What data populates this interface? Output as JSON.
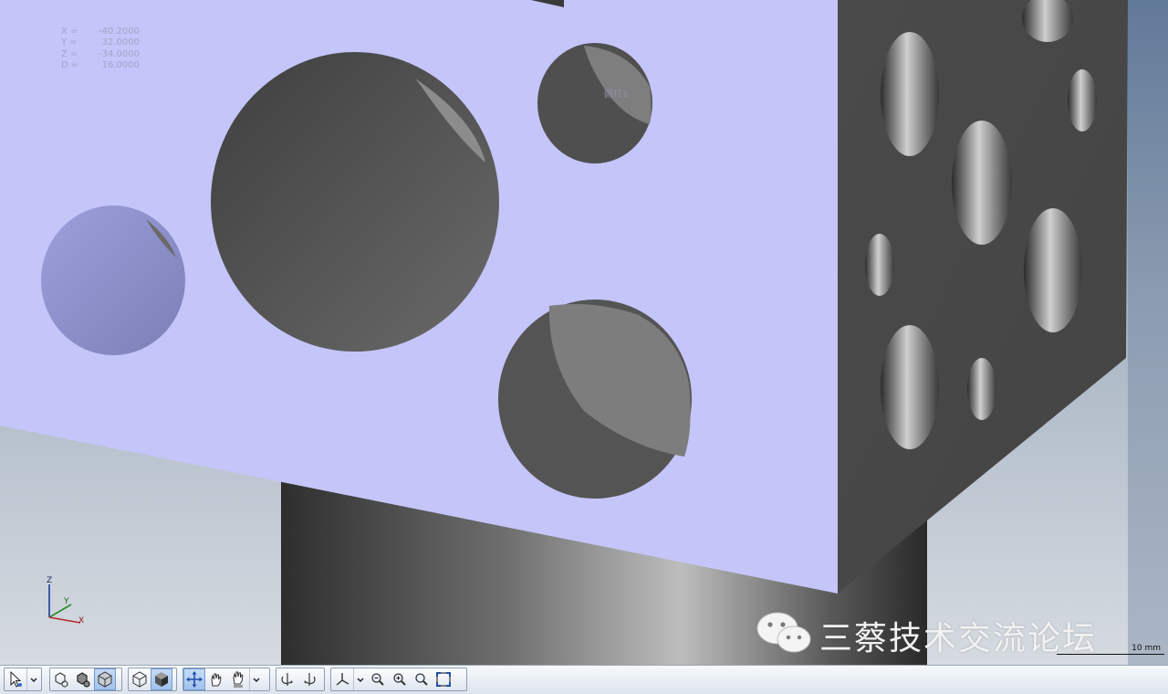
{
  "viewport": {
    "coordinates": [
      {
        "axis": "X =",
        "value": "-40.2000"
      },
      {
        "axis": "Y =",
        "value": "32.0000"
      },
      {
        "axis": "Z =",
        "value": "-34.0000"
      },
      {
        "axis": "D =",
        "value": "16.0000"
      }
    ],
    "feature_label": "圆柱1",
    "triad": {
      "x": "X",
      "y": "Y",
      "z": "Z"
    },
    "scale_bar": "10 mm",
    "watermark_text": "三蔡技术交流论坛",
    "colors": {
      "top_face": "#c4c6f9",
      "side_face": "#4b4b4b",
      "background_top": "#5e7796",
      "background_bottom": "#d4d9df",
      "toolbar_active": "#a8c8f0"
    }
  },
  "toolbar": {
    "buttons": [
      {
        "name": "select-mode-icon",
        "active": false,
        "dropdown": true
      },
      {
        "name": "shaded-edges-icon",
        "active": false
      },
      {
        "name": "shaded-outline-icon",
        "active": false
      },
      {
        "name": "solid-view-icon",
        "active": true
      },
      {
        "name": "wireframe-box-icon",
        "active": false
      },
      {
        "name": "solid-box-icon",
        "active": true
      },
      {
        "name": "pan-move-icon",
        "active": true
      },
      {
        "name": "hand-icon",
        "active": false
      },
      {
        "name": "hand-xyz-icon",
        "active": false,
        "dropdown": true
      },
      {
        "name": "rotate-left-icon",
        "active": false
      },
      {
        "name": "rotate-right-icon",
        "active": false
      },
      {
        "name": "axis-view-icon",
        "active": false,
        "dropdown": true
      },
      {
        "name": "zoom-out-icon",
        "active": false
      },
      {
        "name": "zoom-in-icon",
        "active": false
      },
      {
        "name": "zoom-icon",
        "active": false
      },
      {
        "name": "zoom-fit-icon",
        "active": false
      }
    ]
  }
}
